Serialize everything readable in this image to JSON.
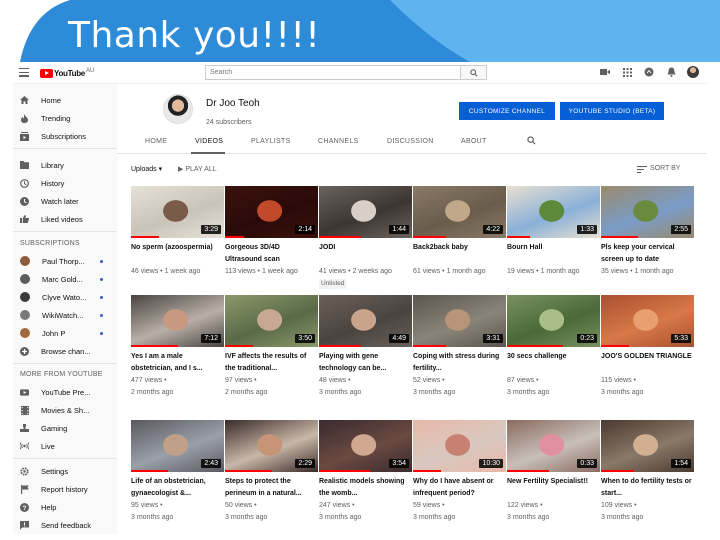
{
  "slide": {
    "title": "Thank you!!!!",
    "banner_color": "#2e8bd8",
    "banner_light": "#5fb4f0"
  },
  "masthead": {
    "logo_text": "YouTube",
    "logo_region": "AU",
    "search_placeholder": "Search"
  },
  "sidebar": {
    "main": [
      {
        "label": "Home",
        "icon": "home-icon"
      },
      {
        "label": "Trending",
        "icon": "fire-icon"
      },
      {
        "label": "Subscriptions",
        "icon": "subscriptions-icon"
      }
    ],
    "library": [
      {
        "label": "Library",
        "icon": "folder-icon"
      },
      {
        "label": "History",
        "icon": "history-icon"
      },
      {
        "label": "Watch later",
        "icon": "clock-icon"
      },
      {
        "label": "Liked videos",
        "icon": "thumbs-up-icon"
      }
    ],
    "subscriptions_heading": "SUBSCRIPTIONS",
    "subscriptions": [
      {
        "label": "Paul Thorp...",
        "color": "#8c5a3c"
      },
      {
        "label": "Marc Gold...",
        "color": "#5b5b5b"
      },
      {
        "label": "Clyve Wato...",
        "color": "#3a3a3a"
      },
      {
        "label": "WikiWatch...",
        "color": "#7a7a7a"
      },
      {
        "label": "John P",
        "color": "#a06a40"
      },
      {
        "label": "Browse chan..."
      }
    ],
    "more_heading": "MORE FROM YOUTUBE",
    "more": [
      {
        "label": "YouTube Pre...",
        "icon": "youtube-premium-icon"
      },
      {
        "label": "Movies & Sh...",
        "icon": "film-icon"
      },
      {
        "label": "Gaming",
        "icon": "gaming-icon"
      },
      {
        "label": "Live",
        "icon": "live-icon"
      }
    ],
    "footer": [
      {
        "label": "Settings",
        "icon": "gear-icon"
      },
      {
        "label": "Report history",
        "icon": "flag-icon"
      },
      {
        "label": "Help",
        "icon": "help-icon"
      },
      {
        "label": "Send feedback",
        "icon": "feedback-icon"
      }
    ]
  },
  "channel": {
    "name": "Dr Joo Teoh",
    "subscribers": "24 subscribers",
    "customize_label": "CUSTOMIZE CHANNEL",
    "studio_label": "YOUTUBE STUDIO (BETA)",
    "accent": "#065fd4"
  },
  "tabs": [
    {
      "label": "HOME"
    },
    {
      "label": "VIDEOS"
    },
    {
      "label": "PLAYLISTS"
    },
    {
      "label": "CHANNELS"
    },
    {
      "label": "DISCUSSION"
    },
    {
      "label": "ABOUT"
    }
  ],
  "filters": {
    "uploads": "Uploads",
    "play_all": "PLAY ALL",
    "sort_by": "SORT BY"
  },
  "videos": [
    {
      "title": "No sperm (azoospermia)",
      "meta1": "46 views • 1 week ago",
      "meta2": "",
      "duration": "3:29",
      "thumb": [
        "#c9c3b8",
        "#7a5a48",
        "#e6e1d8"
      ],
      "progress": 0.3
    },
    {
      "title": "Gorgeous 3D/4D Ultrasound scan",
      "meta1": "113 views • 1 week ago",
      "meta2": "",
      "duration": "2:14",
      "thumb": [
        "#2a0a08",
        "#c24a2a",
        "#3b120c"
      ],
      "progress": 0.2
    },
    {
      "title": "JODI",
      "meta1": "41 views • 2 weeks ago",
      "meta2": "Unlisted",
      "duration": "1:44",
      "thumb": [
        "#3c3632",
        "#d8d0c8",
        "#6a625c"
      ],
      "progress": 0.45
    },
    {
      "title": "Back2back baby",
      "meta1": "61 views • 1 month ago",
      "meta2": "",
      "duration": "4:22",
      "thumb": [
        "#6a5c4c",
        "#c0a888",
        "#8a7a66"
      ],
      "progress": 0.35
    },
    {
      "title": "Bourn Hall",
      "meta1": "19 views • 1 month ago",
      "meta2": "",
      "duration": "1:33",
      "thumb": [
        "#8ab0d8",
        "#5c8a3a",
        "#e8e0d0"
      ],
      "progress": 0.25
    },
    {
      "title": "Pls keep your cervical screen up to date",
      "meta1": "35 views • 1 month ago",
      "meta2": "",
      "duration": "2:55",
      "thumb": [
        "#7a9cc8",
        "#6a8a3e",
        "#9a8a6a"
      ],
      "progress": 0.4
    },
    {
      "title": "Yes I am a male obstetrician, and I s...",
      "meta1": "477 views •",
      "meta2": "2 months ago",
      "duration": "7:12",
      "thumb": [
        "#b8b0a8",
        "#c89880",
        "#4a4440"
      ],
      "progress": 0.5
    },
    {
      "title": "IVF affects the results of the traditional...",
      "meta1": "97 views •",
      "meta2": "2 months ago",
      "duration": "3:50",
      "thumb": [
        "#5a6a48",
        "#c8a890",
        "#8a9868"
      ],
      "progress": 0.3
    },
    {
      "title": "Playing with gene technology can be...",
      "meta1": "48 views •",
      "meta2": "3 months ago",
      "duration": "4:49",
      "thumb": [
        "#4a4440",
        "#c8a48a",
        "#6a6058"
      ],
      "progress": 0.45
    },
    {
      "title": "Coping with stress during fertility...",
      "meta1": "52 views •",
      "meta2": "3 months ago",
      "duration": "3:31",
      "thumb": [
        "#8a8478",
        "#b89478",
        "#5a544c"
      ],
      "progress": 0.35
    },
    {
      "title": "30 secs challenge",
      "meta1": "87 views •",
      "meta2": "3 months ago",
      "duration": "0:23",
      "thumb": [
        "#4a6a38",
        "#a8c088",
        "#7a9060"
      ],
      "progress": 0.6
    },
    {
      "title": "JOO'S GOLDEN TRIANGLE",
      "meta1": "115 views •",
      "meta2": "3 months ago",
      "duration": "5:33",
      "thumb": [
        "#d87848",
        "#e8a070",
        "#a85030"
      ],
      "progress": 0.3
    },
    {
      "title": "Life of an obstetrician, gynaecologist &...",
      "meta1": "95 views •",
      "meta2": "3 months ago",
      "duration": "2:43",
      "thumb": [
        "#9aa0a8",
        "#c0a088",
        "#5a5860"
      ],
      "progress": 0.4
    },
    {
      "title": "Steps to protect the perineum in a natural...",
      "meta1": "50 views •",
      "meta2": "3 months ago",
      "duration": "2:29",
      "thumb": [
        "#c8b8a8",
        "#c89478",
        "#3a2a28"
      ],
      "progress": 0.5
    },
    {
      "title": "Realistic models showing the womb...",
      "meta1": "247 views •",
      "meta2": "3 months ago",
      "duration": "3:54",
      "thumb": [
        "#6a4a40",
        "#d0a890",
        "#3a2a30"
      ],
      "progress": 0.55
    },
    {
      "title": "Why do I have absent or infrequent period?",
      "meta1": "59 views •",
      "meta2": "3 months ago",
      "duration": "10:30",
      "thumb": [
        "#d8c8c0",
        "#c88070",
        "#e8b8a8"
      ],
      "progress": 0.3
    },
    {
      "title": "New Fertility Specialist!!",
      "meta1": "122 views •",
      "meta2": "3 months ago",
      "duration": "0:33",
      "thumb": [
        "#c8c0b8",
        "#e090a0",
        "#8a6a60"
      ],
      "progress": 0.45
    },
    {
      "title": "When to do fertility tests or start...",
      "meta1": "109 views •",
      "meta2": "3 months ago",
      "duration": "1:54",
      "thumb": [
        "#8a7868",
        "#d0b090",
        "#4a3a30"
      ],
      "progress": 0.35
    }
  ]
}
